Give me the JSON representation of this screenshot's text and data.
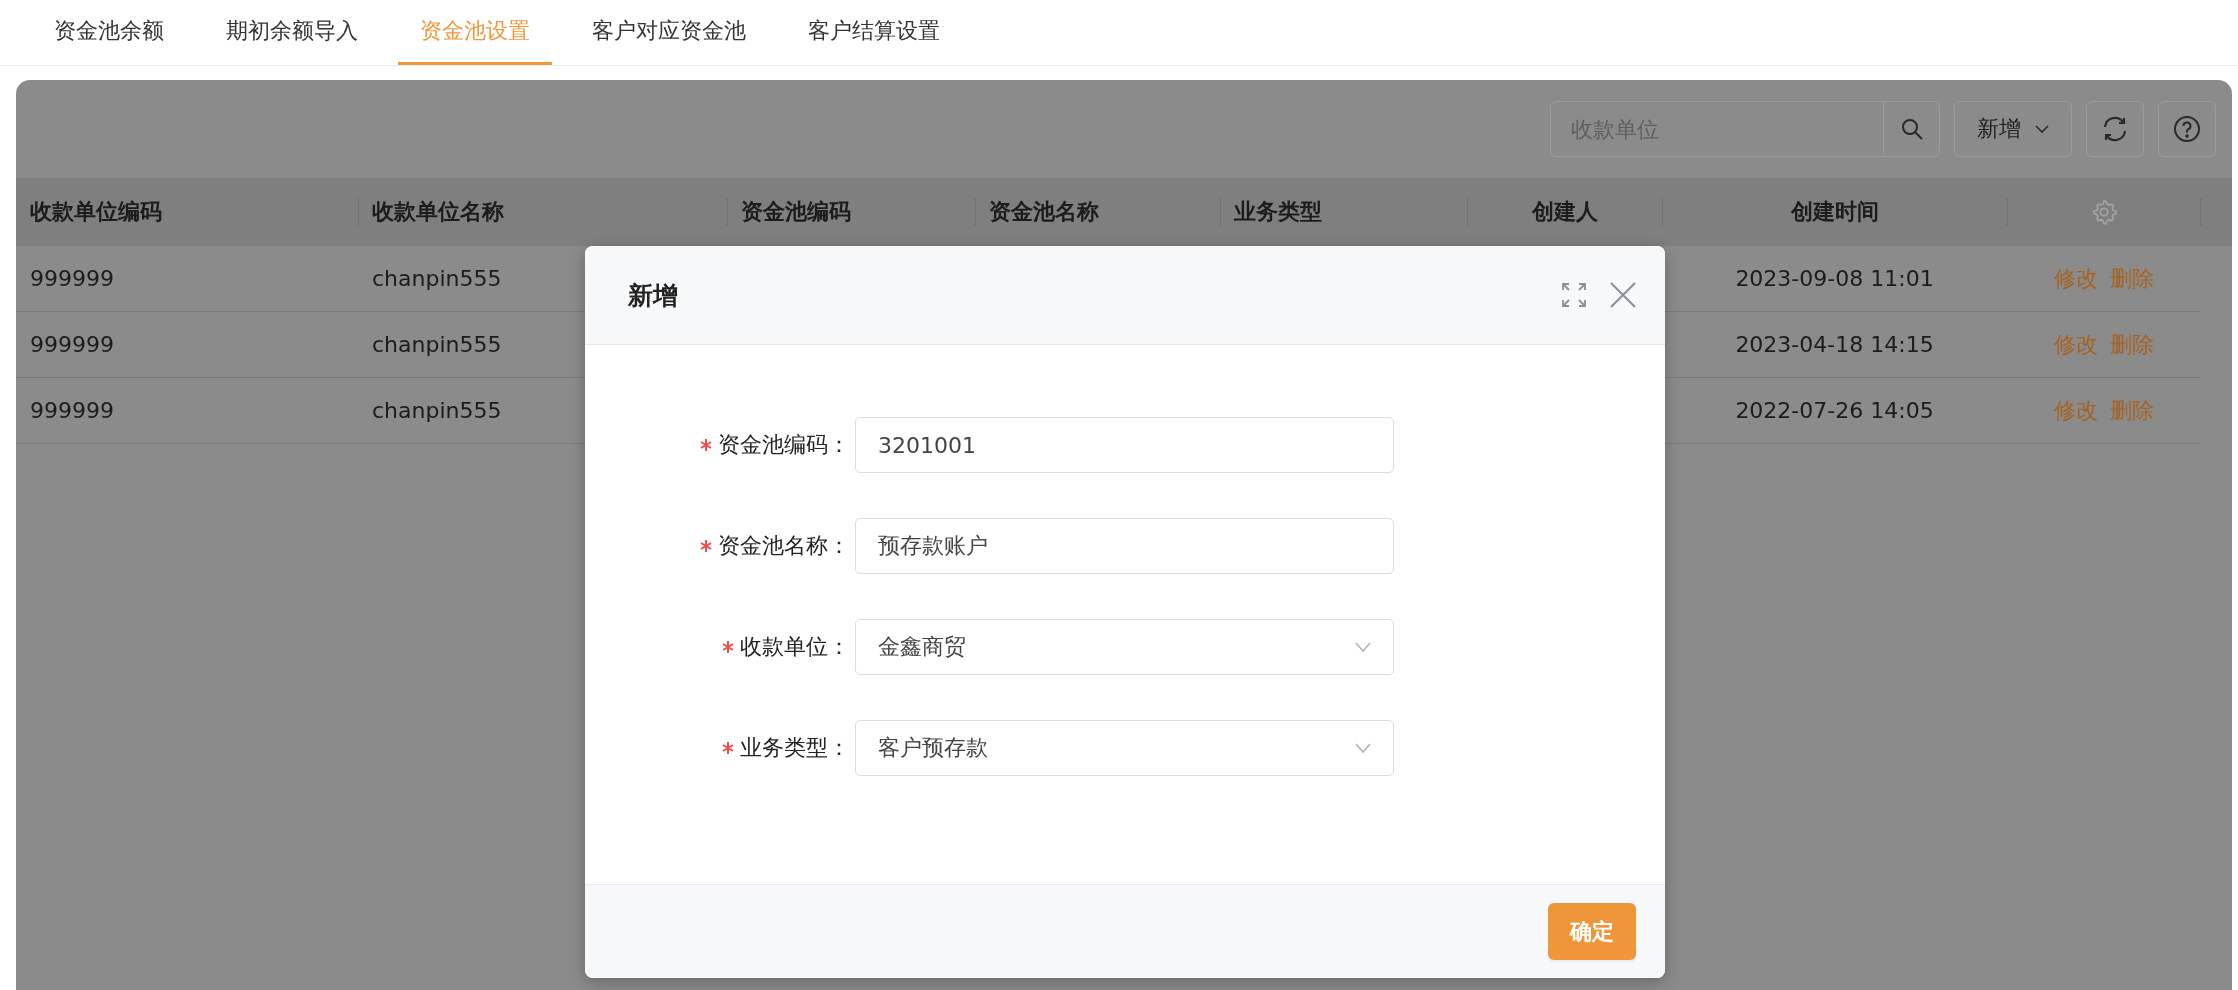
{
  "tabs": [
    {
      "label": "资金池余额",
      "selected": false
    },
    {
      "label": "期初余额导入",
      "selected": false
    },
    {
      "label": "资金池设置",
      "selected": true
    },
    {
      "label": "客户对应资金池",
      "selected": false
    },
    {
      "label": "客户结算设置",
      "selected": false
    }
  ],
  "toolbar": {
    "search": {
      "placeholder": "收款单位"
    },
    "add_menu": {
      "label": "新增"
    }
  },
  "table": {
    "columns": [
      "收款单位编码",
      "收款单位名称",
      "资金池编码",
      "资金池名称",
      "业务类型",
      "创建人",
      "创建时间"
    ],
    "rows": [
      {
        "payee_code": "999999",
        "payee_name": "chanpin555",
        "created_time": "2023-09-08 11:01",
        "actions": [
          "修改",
          "删除"
        ]
      },
      {
        "payee_code": "999999",
        "payee_name": "chanpin555",
        "created_time": "2023-04-18 14:15",
        "actions": [
          "修改",
          "删除"
        ]
      },
      {
        "payee_code": "999999",
        "payee_name": "chanpin555",
        "created_time": "2022-07-26 14:05",
        "actions": [
          "修改",
          "删除"
        ]
      }
    ]
  },
  "dialog": {
    "title": "新增",
    "fields": [
      {
        "label": "资金池编码：",
        "required": true,
        "kind": "input",
        "value": "3201001"
      },
      {
        "label": "资金池名称：",
        "required": true,
        "kind": "input",
        "value": "预存款账户"
      },
      {
        "label": "收款单位：",
        "required": true,
        "kind": "select",
        "value": "金鑫商贸"
      },
      {
        "label": "业务类型：",
        "required": true,
        "kind": "select",
        "value": "客户预存款"
      }
    ],
    "confirm": "确定"
  }
}
